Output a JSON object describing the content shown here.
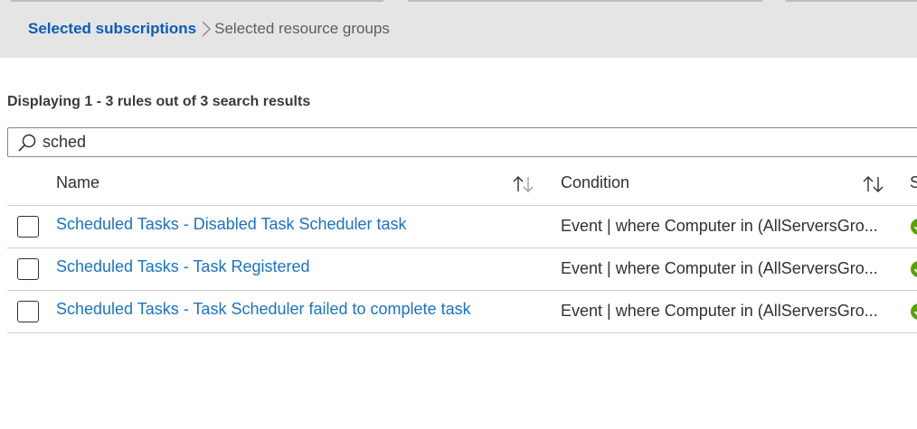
{
  "breadcrumb": {
    "active": "Selected subscriptions",
    "next": "Selected resource groups"
  },
  "results": {
    "summary": "Displaying 1 - 3 rules out of 3 search results"
  },
  "search": {
    "value": "sched"
  },
  "table": {
    "columns": {
      "name": "Name",
      "condition": "Condition",
      "status": "S"
    },
    "rows": [
      {
        "name": "Scheduled Tasks - Disabled Task Scheduler task",
        "condition": "Event | where Computer in (AllServersGro..."
      },
      {
        "name": "Scheduled Tasks - Task Registered",
        "condition": "Event | where Computer in (AllServersGro..."
      },
      {
        "name": "Scheduled Tasks - Task Scheduler failed to complete task",
        "condition": "Event | where Computer in (AllServersGro..."
      }
    ]
  },
  "colors": {
    "accent": "#0a5cba",
    "link": "#1a73c8",
    "status_ok": "#57a300",
    "band": "#e5e5e5"
  },
  "icons": {
    "breadcrumb_separator": "chevron-right-icon",
    "search": "search-icon",
    "sort": "sort-icon",
    "status": "check-circle-icon"
  }
}
